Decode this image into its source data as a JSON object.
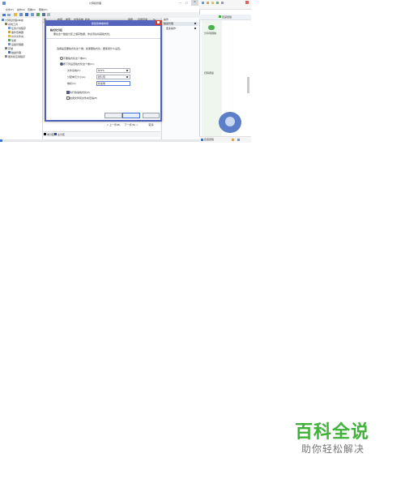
{
  "main_window": {
    "title": "计算机管理",
    "controls": {
      "minimize": "—",
      "maximize": "□",
      "close": "✕"
    },
    "menu": [
      "文件(F)",
      "操作(A)",
      "查看(V)",
      "帮助(H)"
    ],
    "tree": {
      "root": "计算机管理(本地)",
      "items": [
        "系统工具",
        "任务计划程序",
        "事件查看器",
        "共享文件夹",
        "性能",
        "设备管理器",
        "存储",
        "磁盘管理",
        "服务和应用程序"
      ]
    },
    "columns": [
      "卷",
      "布局",
      "类型",
      "文件系统",
      "状态",
      "容量",
      "可用空间",
      "%"
    ],
    "actions_panel": {
      "header": "操作",
      "group": "磁盘管理",
      "item": "更多操作"
    },
    "legend": {
      "unallocated": "未分配",
      "primary": "主分区"
    }
  },
  "dialog": {
    "title": "新建简单卷向导",
    "heading": "格式化分区",
    "description": "要在这个磁盘分区上储存数据，你必须先将其格式化。",
    "prompt": "选择是否要格式化这个卷；如果要格式化，要使用什么设置。",
    "option_no_format": "不要格式化这个卷(D)",
    "option_format": "按下列设置格式化这个卷(O):",
    "fields": {
      "filesystem": {
        "label": "文件系统(F):",
        "value": "NTFS"
      },
      "allocation": {
        "label": "分配单元大小(A):",
        "value": "默认值"
      },
      "volume_label": {
        "label": "卷标(V):",
        "value": "新加卷"
      }
    },
    "quick_format": "执行快速格式化(P)",
    "compression": "启用文件和文件夹压缩(E)",
    "buttons": {
      "back": "< 上一步(B)",
      "next": "下一步(N) >",
      "cancel": "取消"
    }
  },
  "right_window": {
    "tab_label": "百度经验",
    "panel_label": "分享到微信",
    "panel_text": "扫码阅读",
    "bottom_label": "百度经验"
  },
  "watermark": {
    "title": "百科全说",
    "subtitle": "助你轻松解决"
  }
}
